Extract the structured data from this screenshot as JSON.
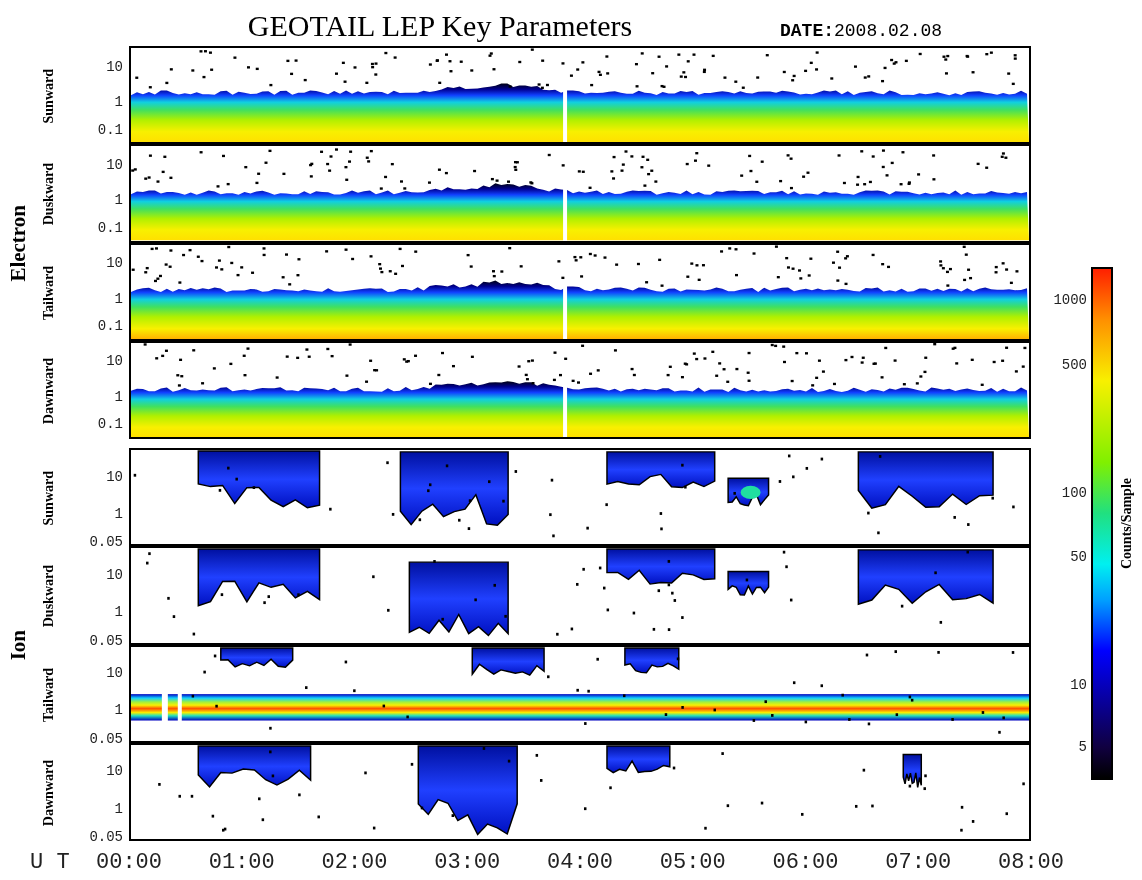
{
  "title": "GEOTAIL LEP Key Parameters",
  "date": {
    "label": "DATE:",
    "value": "2008.02.08"
  },
  "groups": [
    {
      "name": "Electron",
      "kind": "electron",
      "panels": [
        {
          "label": "Sunward",
          "yticks": [
            "10",
            "1",
            "0.1"
          ]
        },
        {
          "label": "Duskward",
          "yticks": [
            "10",
            "1",
            "0.1"
          ]
        },
        {
          "label": "Tailward",
          "yticks": [
            "10",
            "1",
            "0.1"
          ]
        },
        {
          "label": "Dawnward",
          "yticks": [
            "10",
            "1",
            "0.1"
          ]
        }
      ]
    },
    {
      "name": "Ion",
      "kind": "ion",
      "panels": [
        {
          "label": "Sunward",
          "yticks": [
            "10",
            "1",
            "0.05"
          ]
        },
        {
          "label": "Duskward",
          "yticks": [
            "10",
            "1",
            "0.05"
          ]
        },
        {
          "label": "Tailward",
          "yticks": [
            "10",
            "1",
            "0.05"
          ]
        },
        {
          "label": "Dawnward",
          "yticks": [
            "10",
            "1",
            "0.05"
          ]
        }
      ]
    }
  ],
  "x_axis": {
    "label": "U T",
    "ticks": [
      "00:00",
      "01:00",
      "02:00",
      "03:00",
      "04:00",
      "05:00",
      "06:00",
      "07:00",
      "08:00"
    ]
  },
  "colorbar": {
    "label": "Counts/Sample",
    "ticks": [
      "1000",
      "500",
      "100",
      "50",
      "10",
      "5"
    ]
  }
}
